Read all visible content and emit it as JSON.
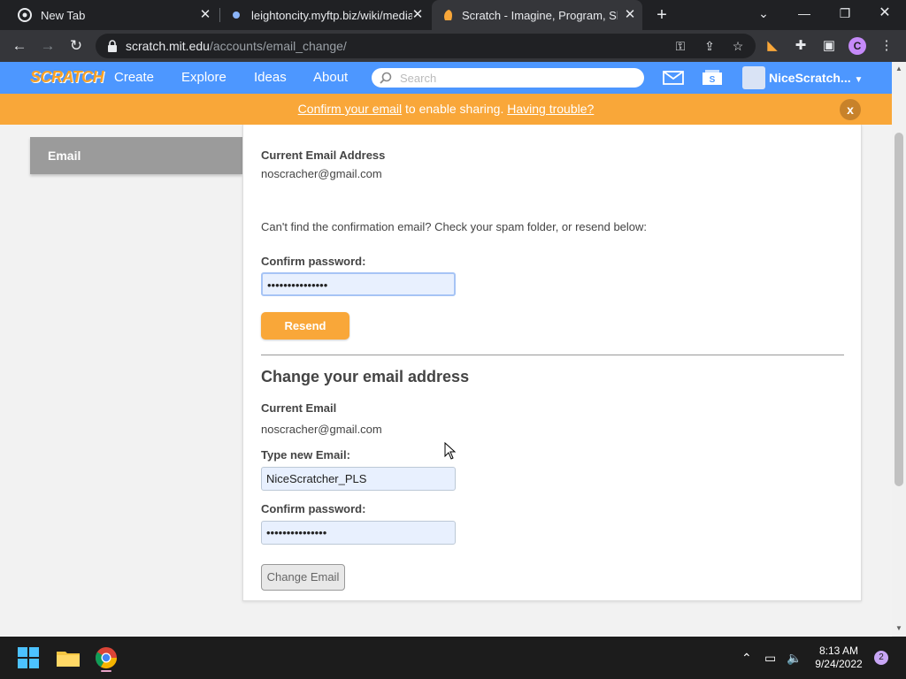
{
  "browser": {
    "tabs": [
      {
        "title": "New Tab",
        "active": false
      },
      {
        "title": "leightoncity.myftp.biz/wiki/media",
        "active": false
      },
      {
        "title": "Scratch - Imagine, Program, Share",
        "active": true
      }
    ],
    "url_host": "scratch.mit.edu",
    "url_path": "/accounts/email_change/",
    "profile_initial": "C"
  },
  "scratch_nav": {
    "logo": "SCRATCH",
    "links": [
      "Create",
      "Explore",
      "Ideas",
      "About"
    ],
    "search_placeholder": "Search",
    "username": "NiceScratch..."
  },
  "banner": {
    "link1": "Confirm your email",
    "middle": " to enable sharing. ",
    "link2": "Having trouble?",
    "close": "x"
  },
  "sidebar": {
    "active_item": "Email"
  },
  "form": {
    "current_email_label": "Current Email Address",
    "current_email_value": "noscracher@gmail.com",
    "resend_hint": "Can't find the confirmation email? Check your spam folder, or resend below:",
    "confirm_password_label": "Confirm password:",
    "resend_password_value": "•••••••••••••••",
    "resend_button": "Resend",
    "change_heading": "Change your email address",
    "current_email_label2": "Current Email",
    "current_email_value2": "noscracher@gmail.com",
    "new_email_label": "Type new Email:",
    "new_email_value": "NiceScratcher_PLS",
    "confirm_password_label2": "Confirm password:",
    "change_password_value": "•••••••••••••••",
    "change_button": "Change Email"
  },
  "taskbar": {
    "time": "8:13 AM",
    "date": "9/24/2022",
    "notification_count": "2"
  }
}
